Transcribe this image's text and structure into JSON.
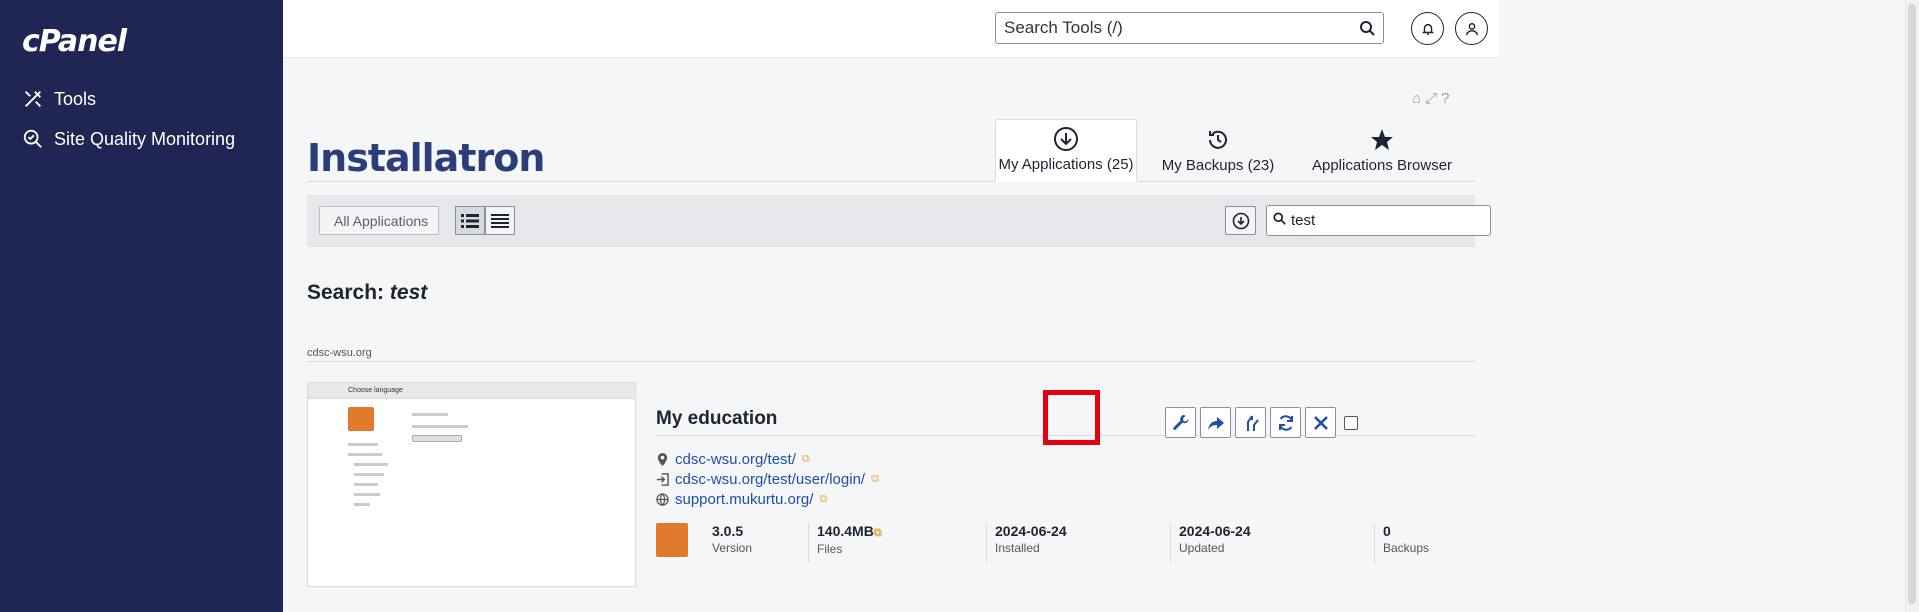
{
  "sidebar": {
    "logo": "cPanel",
    "items": [
      {
        "label": "Tools",
        "icon": "tools-icon"
      },
      {
        "label": "Site Quality Monitoring",
        "icon": "site-quality-icon"
      }
    ]
  },
  "header": {
    "search_placeholder": "Search Tools (/)"
  },
  "main": {
    "brand": "Installatron",
    "tabs": [
      {
        "label": "My Applications (25)",
        "icon": "download-circle-icon",
        "active": true
      },
      {
        "label": "My Backups (23)",
        "icon": "history-icon",
        "active": false
      },
      {
        "label": "Applications Browser",
        "icon": "star-icon",
        "active": false
      }
    ],
    "toolbar": {
      "all_apps_label": "All Applications",
      "filter_value": "test"
    },
    "search": {
      "prefix": "Search:",
      "term": "test"
    },
    "domain": "cdsc-wsu.org",
    "thumbnail": {
      "bar_text": "Choose language"
    },
    "app": {
      "title": "My education",
      "links": [
        {
          "text": "cdsc-wsu.org/test/",
          "icon": "location-pin-icon"
        },
        {
          "text": "cdsc-wsu.org/test/user/login/",
          "icon": "login-icon"
        },
        {
          "text": "support.mukurtu.org/",
          "icon": "globe-icon"
        }
      ],
      "stats": [
        {
          "value": "3.0.5",
          "label": "Version"
        },
        {
          "value": "140.4MB",
          "label": "Files"
        },
        {
          "value": "2024-06-24",
          "label": "Installed"
        },
        {
          "value": "2024-06-24",
          "label": "Updated"
        },
        {
          "value": "0",
          "label": "Backups"
        }
      ]
    }
  },
  "colors": {
    "sidebar_bg": "#1f2654",
    "link": "#1f4fa8",
    "highlight": "#e4000f",
    "app_logo": "#e07b2d"
  }
}
